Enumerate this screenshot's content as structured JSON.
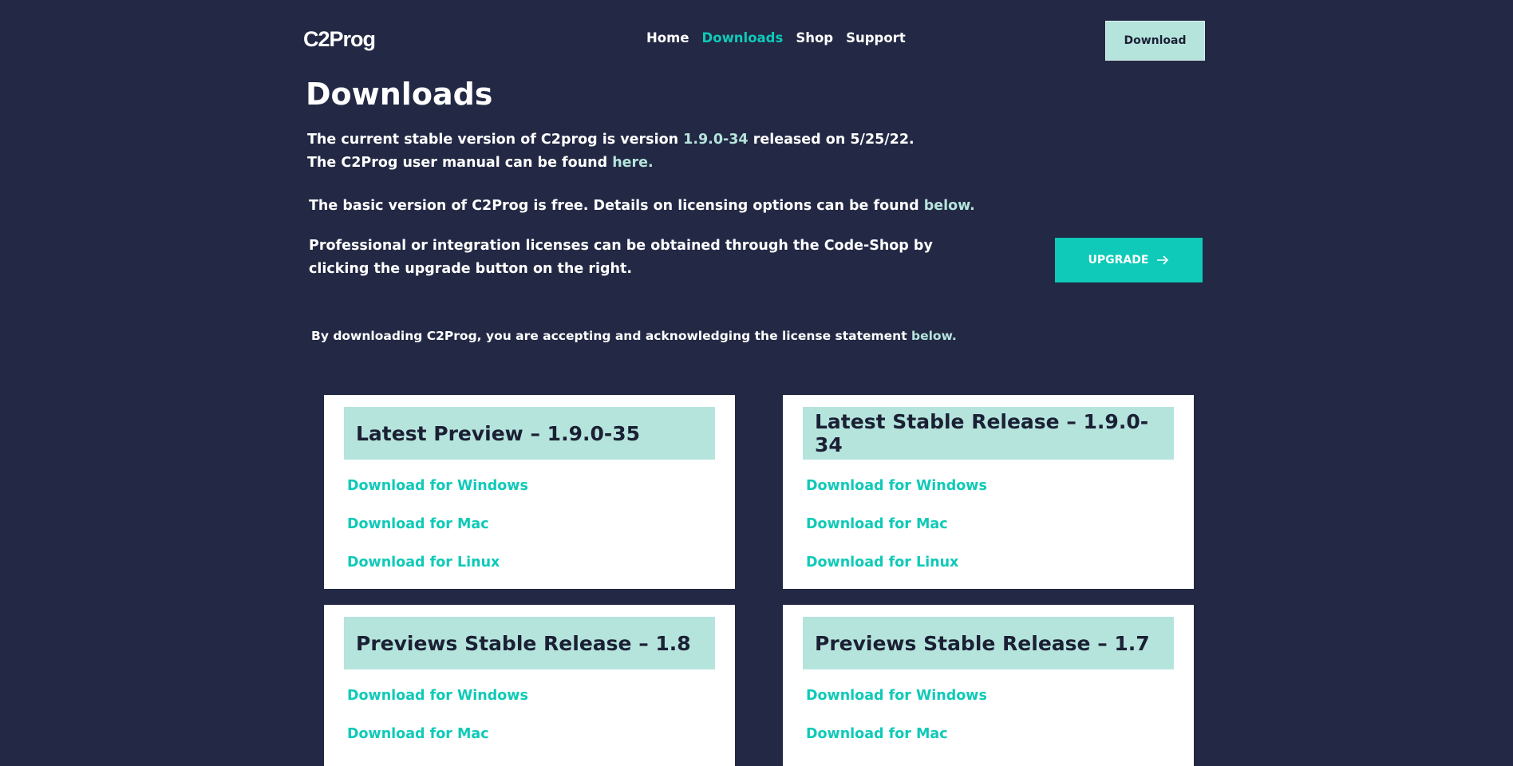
{
  "header": {
    "logo": "C2Prog",
    "nav": [
      {
        "label": "Home"
      },
      {
        "label": "Downloads"
      },
      {
        "label": "Shop"
      },
      {
        "label": "Support"
      }
    ],
    "download_button": "Download"
  },
  "main": {
    "title": "Downloads",
    "version_line_prefix": "The current stable version of C2prog is version ",
    "version_link": "1.9.0-34",
    "version_line_suffix": " released on 5/25/22.",
    "manual_line_prefix": "The C2Prog user manual can be found ",
    "manual_link": "here.",
    "licensing_prefix": "The basic version of C2Prog is free. Details on licensing options can be found ",
    "licensing_link": "below.",
    "professional_text": "Professional or integration licenses can be obtained through the Code-Shop by clicking the upgrade button on the right.",
    "upgrade_button": "UPGRADE",
    "license_note_prefix": "By downloading C2Prog, you are accepting and acknowledging the license statement ",
    "license_note_link": "below."
  },
  "cards": [
    {
      "title": "Latest Preview – 1.9.0-35",
      "links": [
        "Download for Windows",
        "Download for Mac",
        "Download for Linux"
      ]
    },
    {
      "title": "Latest Stable Release – 1.9.0-34",
      "links": [
        "Download for Windows",
        "Download for Mac",
        "Download for Linux"
      ]
    },
    {
      "title": "Previews Stable Release – 1.8",
      "links": [
        "Download for Windows",
        "Download for Mac"
      ]
    },
    {
      "title": "Previews Stable Release – 1.7",
      "links": [
        "Download for Windows",
        "Download for Mac"
      ]
    }
  ],
  "colors": {
    "background": "#232844",
    "accent": "#0fcab8",
    "light_accent": "#b5e4dd",
    "card": "#ffffff"
  }
}
